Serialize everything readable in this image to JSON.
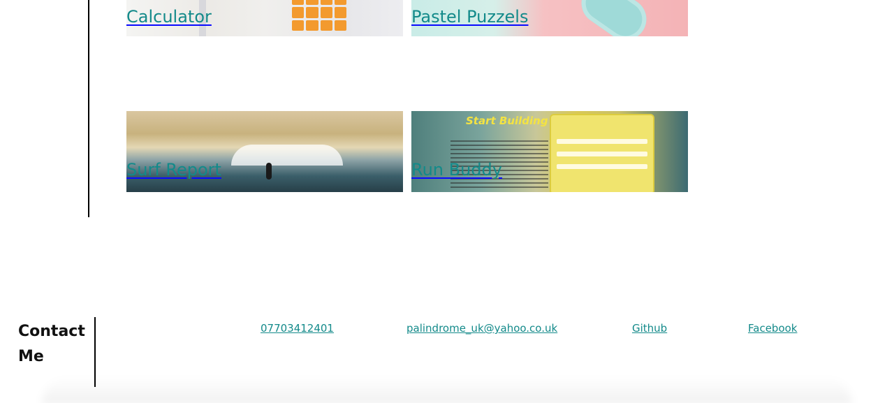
{
  "projects": [
    {
      "title": "Calculator"
    },
    {
      "title": "Pastel Puzzels"
    },
    {
      "title": "Surf Report"
    },
    {
      "title": "Run Buddy"
    }
  ],
  "run_buddy_image": {
    "headline": "Start Building Habits."
  },
  "contact": {
    "heading": "Contact Me",
    "phone": "07703412401",
    "email": "palindrome_uk@yahoo.co.uk",
    "github": "Github",
    "facebook": "Facebook"
  },
  "colors": {
    "link": "#138a8a",
    "rule": "#000000"
  }
}
